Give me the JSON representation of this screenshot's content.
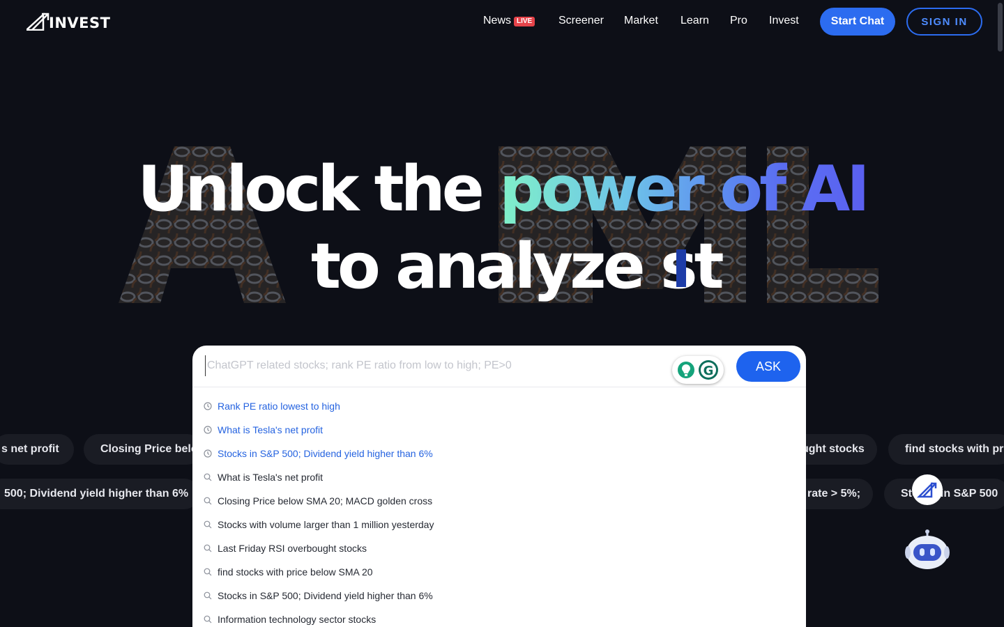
{
  "brand": {
    "logo_text": "INVEST"
  },
  "nav": {
    "items": [
      {
        "label": "News",
        "badge": "LIVE"
      },
      {
        "label": "Screener"
      },
      {
        "label": "Market"
      },
      {
        "label": "Learn"
      },
      {
        "label": "Pro"
      },
      {
        "label": "Invest"
      }
    ],
    "start_chat": "Start Chat",
    "sign_in": "SIGN IN"
  },
  "hero": {
    "line1_plain": "Unlock the ",
    "line1_grad1": "power of ",
    "line1_grad2": "AI",
    "line2": "to analyze st",
    "background_word": "AI"
  },
  "search": {
    "placeholder": "ChatGPT related stocks; rank PE ratio from low to high; PE>0",
    "value": "",
    "ask_label": "ASK"
  },
  "suggestions": {
    "history": [
      "Rank PE ratio lowest to high",
      "What is Tesla's net profit",
      "Stocks in S&P 500; Dividend yield higher than 6%"
    ],
    "popular": [
      "What is Tesla's net profit",
      "Closing Price below SMA 20; MACD golden cross",
      "Stocks with volume larger than 1 million yesterday",
      "Last Friday RSI overbought stocks",
      "find stocks with price below SMA 20",
      "Stocks in S&P 500; Dividend yield higher than 6%",
      "Information technology sector stocks"
    ]
  },
  "chips": {
    "row1": [
      "s net profit",
      "Closing Price below",
      "ught stocks",
      "find stocks with pri"
    ],
    "row2": [
      "500; Dividend yield higher than 6%",
      "rate > 5%;",
      "Stocks in S&P 500"
    ]
  },
  "colors": {
    "background": "#0d0f17",
    "accent": "#2c6cf0",
    "live_badge": "#e5434a",
    "history_link": "#2563e0"
  },
  "icons": {
    "history": "clock-icon",
    "popular": "search-icon",
    "grammarly": "grammarly-icon",
    "assistant": "robot-icon"
  }
}
